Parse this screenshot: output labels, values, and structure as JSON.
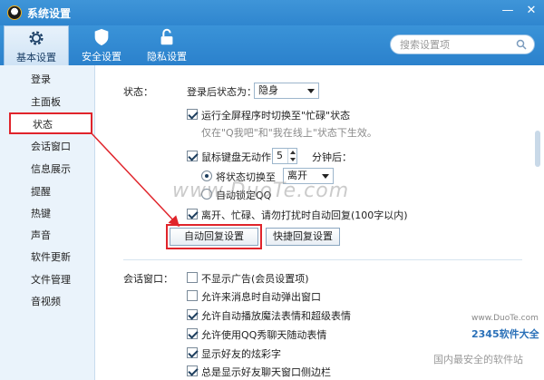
{
  "window": {
    "title": "系统设置"
  },
  "toolbar": {
    "tabs": [
      {
        "label": "基本设置",
        "icon": "gear-icon"
      },
      {
        "label": "安全设置",
        "icon": "shield-icon"
      },
      {
        "label": "隐私设置",
        "icon": "lock-icon"
      }
    ],
    "search_placeholder": "搜索设置项"
  },
  "sidebar": {
    "items": [
      "登录",
      "主面板",
      "状态",
      "会话窗口",
      "信息展示",
      "提醒",
      "热键",
      "声音",
      "软件更新",
      "文件管理",
      "音视频"
    ],
    "active": "状态"
  },
  "status": {
    "section_label": "状态：",
    "login_status_label": "登录后状态为：",
    "login_status_value": "隐身",
    "fullscreen_busy": "运行全屏程序时切换至\"忙碌\"状态",
    "fullscreen_note": "仅在\"Q我吧\"和\"我在线上\"状态下生效。",
    "idle_label": "鼠标键盘无动作",
    "idle_minutes": "5",
    "idle_suffix": "分钟后：",
    "switch_to_label": "将状态切换至",
    "switch_to_value": "离开",
    "auto_lock": "自动锁定QQ",
    "auto_reply": "离开、忙碌、请勿打扰时自动回复(100字以内)",
    "auto_reply_btn": "自动回复设置",
    "quick_reply_btn": "快捷回复设置"
  },
  "chat": {
    "section_label": "会话窗口：",
    "options": [
      {
        "label": "不显示广告(会员设置项)",
        "checked": false
      },
      {
        "label": "允许来消息时自动弹出窗口",
        "checked": false
      },
      {
        "label": "允许自动播放魔法表情和超级表情",
        "checked": true
      },
      {
        "label": "允许使用QQ秀聊天随动表情",
        "checked": true
      },
      {
        "label": "显示好友的炫彩字",
        "checked": true
      },
      {
        "label": "总是显示好友聊天窗口侧边栏",
        "checked": true
      }
    ]
  },
  "watermarks": {
    "duote": "www.DuoTe.com",
    "site_small": "www.DuoTe.com",
    "brand": "2345软件大全",
    "brand_sub": "国内最安全的软件站"
  },
  "colors": {
    "accent": "#2f86cf",
    "highlight": "#e0242b"
  }
}
